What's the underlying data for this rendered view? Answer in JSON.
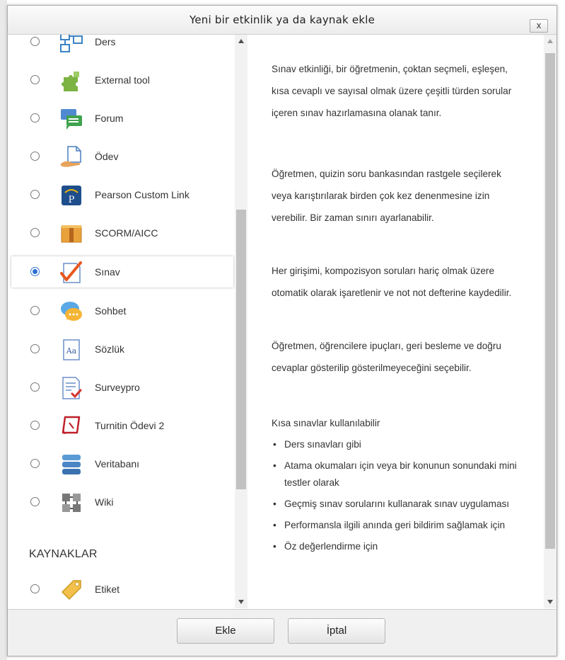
{
  "dialog": {
    "title": "Yeni bir etkinlik ya da kaynak ekle",
    "close_label": "x"
  },
  "activities": [
    {
      "label": "Ders",
      "icon": "lesson-icon",
      "selected": false
    },
    {
      "label": "External tool",
      "icon": "puzzle-icon",
      "selected": false
    },
    {
      "label": "Forum",
      "icon": "forum-icon",
      "selected": false
    },
    {
      "label": "Ödev",
      "icon": "assignment-icon",
      "selected": false
    },
    {
      "label": "Pearson Custom Link",
      "icon": "pearson-icon",
      "selected": false
    },
    {
      "label": "SCORM/AICC",
      "icon": "scorm-package-icon",
      "selected": false
    },
    {
      "label": "Sınav",
      "icon": "quiz-checkmark-icon",
      "selected": true
    },
    {
      "label": "Sohbet",
      "icon": "chat-icon",
      "selected": false
    },
    {
      "label": "Sözlük",
      "icon": "glossary-icon",
      "selected": false
    },
    {
      "label": "Surveypro",
      "icon": "survey-icon",
      "selected": false
    },
    {
      "label": "Turnitin Ödevi 2",
      "icon": "turnitin-icon",
      "selected": false
    },
    {
      "label": "Veritabanı",
      "icon": "database-icon",
      "selected": false
    },
    {
      "label": "Wiki",
      "icon": "wiki-icon",
      "selected": false
    }
  ],
  "resources_heading": "KAYNAKLAR",
  "resources": [
    {
      "label": "Etiket",
      "icon": "label-tag-icon",
      "selected": false
    }
  ],
  "description": {
    "paragraphs": [
      "Sınav etkinliği, bir öğretmenin, çoktan seçmeli, eşleşen, kısa cevaplı ve sayısal olmak üzere çeşitli türden sorular içeren sınav hazırlamasına olanak tanır.",
      "Öğretmen, quizin soru bankasından rastgele seçilerek veya karıştırılarak birden çok kez denenmesine izin verebilir. Bir zaman sınırı ayarlanabilir.",
      "Her girişimi, kompozisyon soruları hariç olmak üzere otomatik olarak işaretlenir ve not not defterine kaydedilir.",
      "Öğretmen, öğrencilere ipuçları, geri besleme ve doğru cevaplar gösterilip gösterilmeyeceğini seçebilir.",
      "Kısa sınavlar kullanılabilir"
    ],
    "bullets": [
      "Ders sınavları gibi",
      "Atama okumaları için veya bir konunun sonundaki mini testler olarak",
      "Geçmiş sınav sorularını kullanarak sınav uygulaması",
      "Performansla ilgili anında geri bildirim sağlamak için",
      "Öz değerlendirme için"
    ]
  },
  "footer": {
    "add_label": "Ekle",
    "cancel_label": "İptal"
  },
  "colors": {
    "radio_selected": "#2d6fd2",
    "checkmark": "#e8571e"
  }
}
